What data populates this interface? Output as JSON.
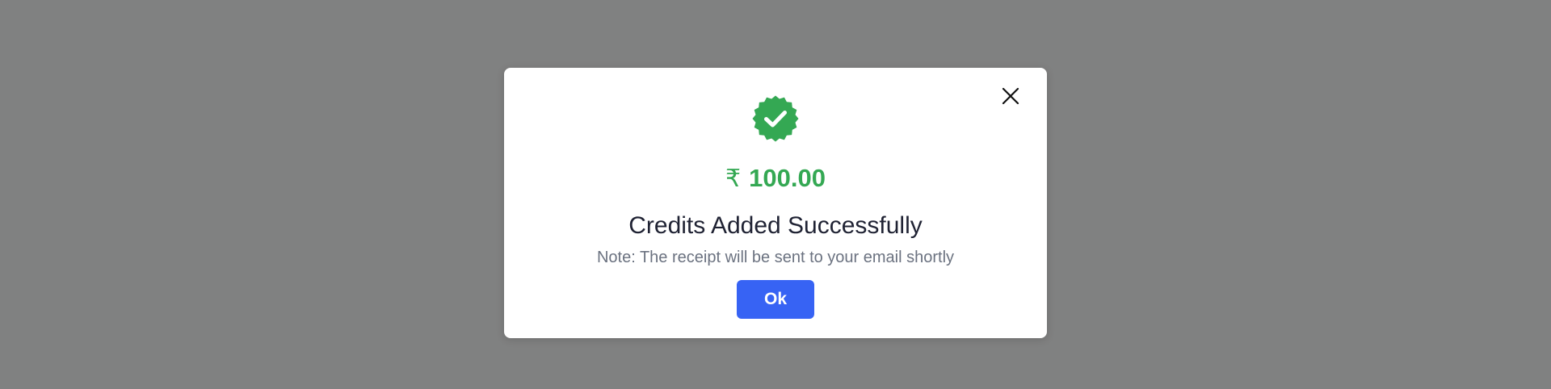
{
  "modal": {
    "amount": {
      "currency_symbol": "₹",
      "value": "100.00"
    },
    "title": "Credits Added Successfully",
    "note": "Note: The receipt will be sent to your email shortly",
    "ok_label": "Ok",
    "icons": {
      "success": "verified-badge-check-icon",
      "close": "close-icon"
    }
  },
  "colors": {
    "backdrop": "#808181",
    "success_green": "#34a853",
    "primary_button": "#3763f4",
    "title_text": "#1f2233",
    "note_text": "#6b7280"
  }
}
